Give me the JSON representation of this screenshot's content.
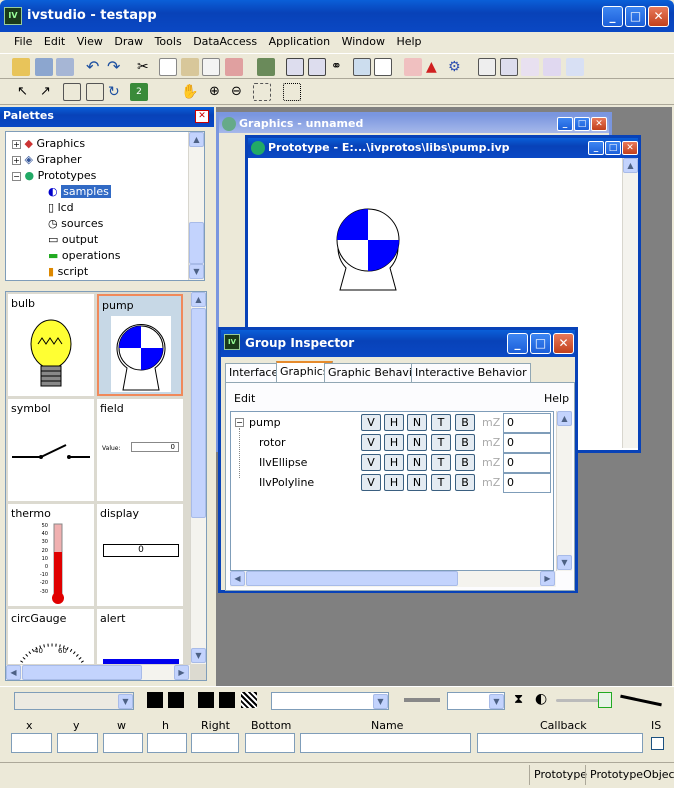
{
  "app": {
    "title": "ivstudio - testapp"
  },
  "menu": [
    "File",
    "Edit",
    "View",
    "Draw",
    "Tools",
    "DataAccess",
    "Application",
    "Window",
    "Help"
  ],
  "palettes": {
    "title": "Palettes",
    "tree": [
      {
        "label": "Graphics",
        "icon": "shapes-icon"
      },
      {
        "label": "Grapher",
        "icon": "grapher-icon"
      },
      {
        "label": "Prototypes",
        "icon": "prototypes-icon"
      },
      {
        "label": "samples",
        "icon": "samples-icon",
        "selected": true
      },
      {
        "label": "lcd",
        "icon": "lcd-icon"
      },
      {
        "label": "sources",
        "icon": "clock-icon"
      },
      {
        "label": "output",
        "icon": "output-icon"
      },
      {
        "label": "operations",
        "icon": "operations-icon"
      },
      {
        "label": "script",
        "icon": "script-icon"
      }
    ],
    "items": [
      "bulb",
      "pump",
      "symbol",
      "field",
      "thermo",
      "display",
      "circGauge",
      "alert"
    ],
    "field_value_label": "Value:",
    "field_value": "0",
    "display_value": "0",
    "thermo_ticks": [
      "50",
      "40",
      "30",
      "20",
      "10",
      "0",
      "-10",
      "-20",
      "-30"
    ],
    "gauge_ticks": [
      "40",
      "60"
    ]
  },
  "graphics_window": {
    "title": "Graphics - unnamed"
  },
  "prototype_window": {
    "title": "Prototype - E:...\\ivprotos\\libs\\pump.ivp"
  },
  "inspector": {
    "title": "Group Inspector",
    "tabs": [
      "Interface",
      "Graphics",
      "Graphic Behavior",
      "Interactive Behavior"
    ],
    "active_tab": "Graphics",
    "edit": "Edit",
    "help": "Help",
    "buttons": [
      "V",
      "H",
      "N",
      "T",
      "B"
    ],
    "mz": "mZ",
    "rows": [
      {
        "name": "pump",
        "value": "0"
      },
      {
        "name": "rotor",
        "value": "0"
      },
      {
        "name": "IlvEllipse",
        "value": "0"
      },
      {
        "name": "IlvPolyline",
        "value": "0"
      }
    ]
  },
  "bottom": {
    "columns": [
      "x",
      "y",
      "w",
      "h",
      "Right",
      "Bottom",
      "Name",
      "Callback",
      "IS"
    ]
  },
  "status": [
    "Prototype",
    "PrototypeObject"
  ]
}
